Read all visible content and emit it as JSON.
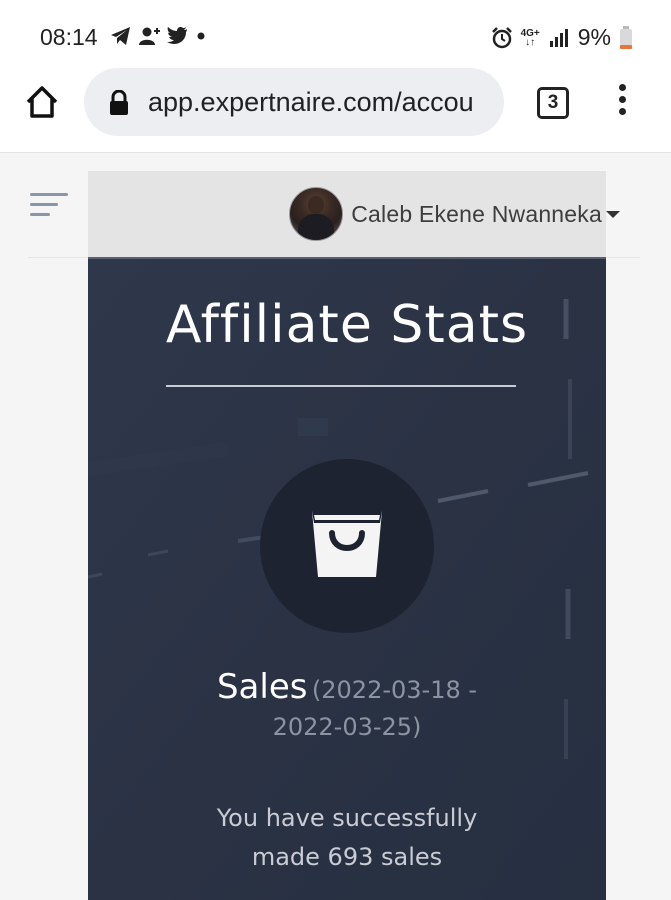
{
  "status_bar": {
    "time": "08:14",
    "network": "4G+",
    "battery": "9%",
    "left_icons": [
      "telegram-icon",
      "add-contact-icon",
      "twitter-icon",
      "dot-icon"
    ],
    "right_icons": [
      "alarm-icon",
      "network-icon",
      "signal-icon",
      "battery-icon"
    ]
  },
  "browser": {
    "url": "app.expertnaire.com/accou",
    "tab_count": "3"
  },
  "header": {
    "user_name": "Caleb Ekene Nwanneka"
  },
  "affiliate": {
    "title": "Affiliate Stats",
    "sales_label": "Sales",
    "date_range_start": "(2022-03-18 -",
    "date_range_end": "2022-03-25)",
    "success_line1": "You have successfully",
    "success_line2": "made 693 sales"
  },
  "colors": {
    "panel_bg": "#2b3345",
    "icon_circle": "#1d2330",
    "accent_text": "#ffffff"
  }
}
